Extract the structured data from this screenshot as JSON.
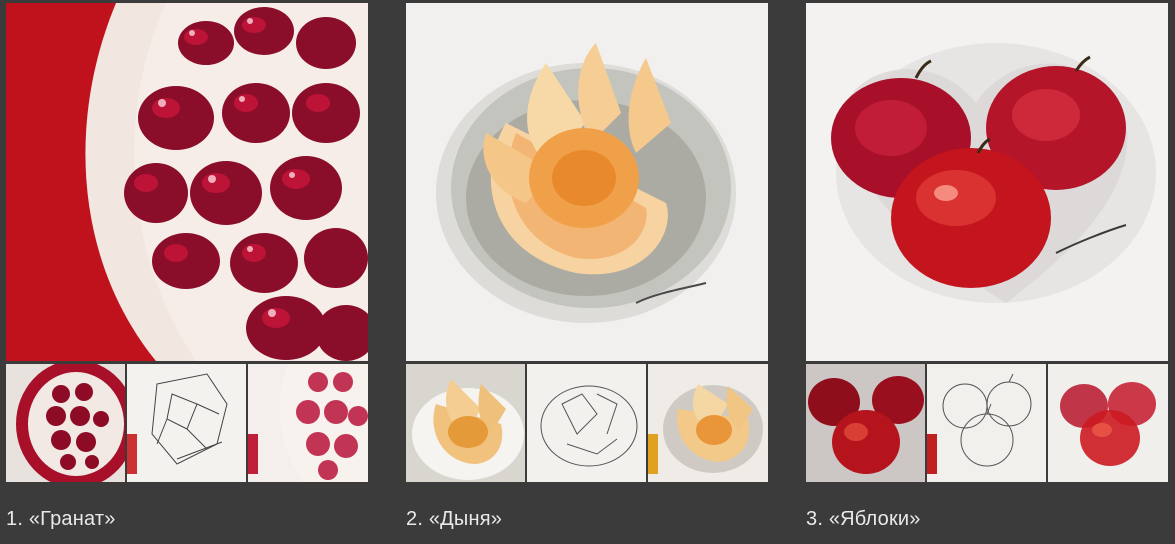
{
  "gallery": {
    "background": "#3b3b3b",
    "items": [
      {
        "caption": "1. «Гранат»",
        "subject": "pomegranate",
        "thumbnails": [
          "reference-photo",
          "line-sketch",
          "work-in-progress"
        ]
      },
      {
        "caption": "2. «Дыня»",
        "subject": "melon",
        "thumbnails": [
          "reference-photo",
          "line-sketch",
          "work-in-progress"
        ]
      },
      {
        "caption": "3. «Яблоки»",
        "subject": "apples",
        "thumbnails": [
          "reference-photo",
          "line-sketch",
          "work-in-progress"
        ]
      }
    ]
  }
}
